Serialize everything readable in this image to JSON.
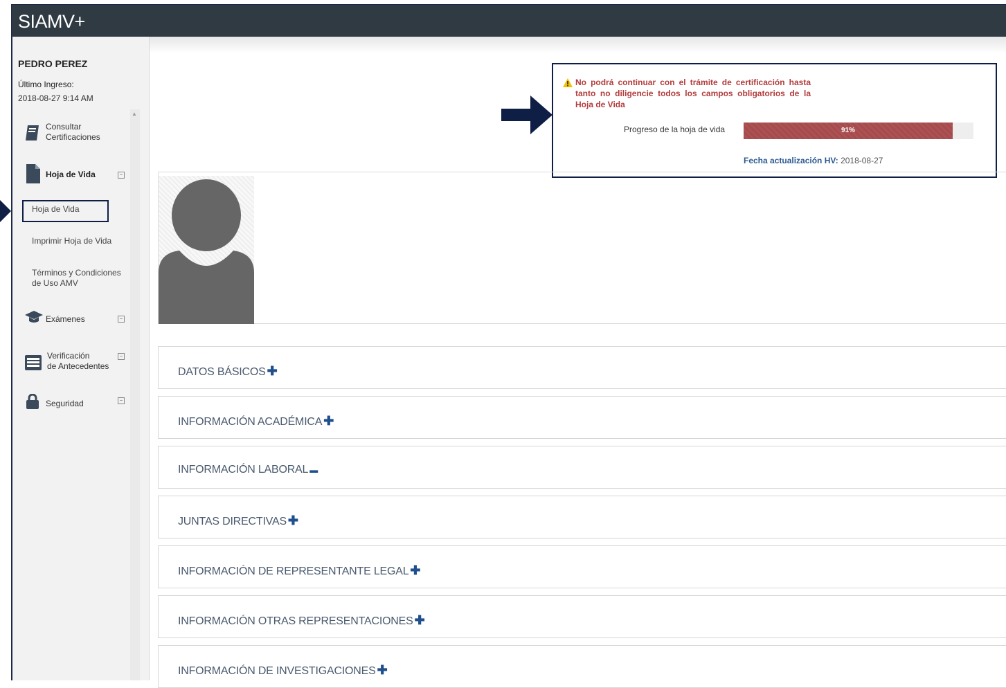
{
  "app": {
    "title": "SIAMV+"
  },
  "user": {
    "name": "PEDRO PEREZ",
    "last_login_label": "Último Ingreso:",
    "last_login_value": "2018-08-27 9:14 AM"
  },
  "sidebar": {
    "items": [
      {
        "label": "Consultar\nCertificaciones",
        "icon": "book-icon"
      },
      {
        "label": "Hoja de Vida",
        "icon": "document-icon",
        "toggle": "⊟"
      },
      {
        "label": "Exámenes",
        "icon": "graduation-cap-icon",
        "toggle": "⊟"
      },
      {
        "label": "Verificación\nde Antecedentes",
        "icon": "list-card-icon",
        "toggle": "⊟"
      },
      {
        "label": "Seguridad",
        "icon": "lock-icon",
        "toggle": "⊟"
      }
    ],
    "sub_items": [
      {
        "label": "Hoja de Vida"
      },
      {
        "label": "Imprimir Hoja de Vida"
      },
      {
        "label": "Términos y Condiciones\nde Uso AMV"
      }
    ]
  },
  "alert": {
    "message": "No podrá continuar con el trámite de certificación hasta tanto no diligencie todos los campos obligatorios de la Hoja de Vida",
    "progress_label": "Progreso de la hoja de vida",
    "progress_value": 91,
    "progress_text": "91%",
    "update_label": "Fecha actualización HV:",
    "update_value": "2018-08-27",
    "colors": {
      "alert_text": "#b23b3b",
      "progress_fill": "#a54b4e",
      "frame": "#0f1e45"
    }
  },
  "sections": [
    {
      "title": "DATOS BÁSICOS",
      "toggle": "✚"
    },
    {
      "title": "INFORMACIÓN ACADÉMICA",
      "toggle": "✚"
    },
    {
      "title": "INFORMACIÓN LABORAL",
      "toggle": "▬"
    },
    {
      "title": "JUNTAS DIRECTIVAS",
      "toggle": "✚"
    },
    {
      "title": "INFORMACIÓN DE REPRESENTANTE LEGAL",
      "toggle": "✚"
    },
    {
      "title": "INFORMACIÓN OTRAS REPRESENTACIONES",
      "toggle": "✚"
    },
    {
      "title": "INFORMACIÓN DE INVESTIGACIONES",
      "toggle": "✚"
    }
  ]
}
